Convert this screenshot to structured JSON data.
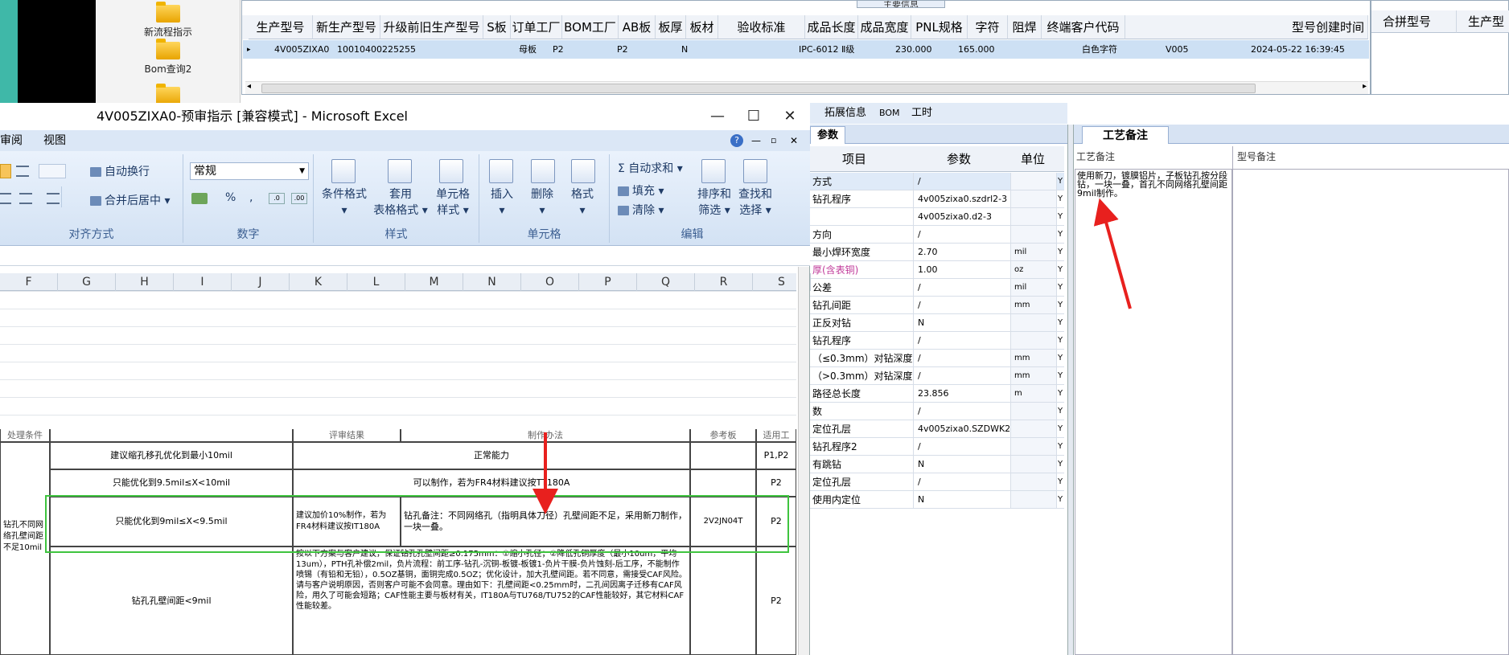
{
  "desktop": {
    "icons": [
      {
        "label": "新流程指示"
      },
      {
        "label": "Bom查询2"
      },
      {
        "label": ""
      }
    ]
  },
  "top_grid": {
    "tab_label": "主要信息",
    "columns": [
      "生产型号",
      "新生产型号",
      "升级前旧生产型号",
      "S板",
      "订单工厂",
      "BOM工厂",
      "AB板",
      "板厚",
      "板材",
      "验收标准",
      "成品长度",
      "成品宽度",
      "PNL规格",
      "字符",
      "阻焊",
      "终端客户代码",
      "型号创建时间"
    ],
    "row": {
      "marker": "▸",
      "production_model": "4V005ZIXA0",
      "new_model": "10010400225255",
      "old_model": "",
      "s_board": "母板",
      "order_factory": "P2",
      "bom_factory": "P2",
      "ab_board": "N",
      "thickness": "",
      "material": "",
      "standard": "IPC-6012 Ⅱ级",
      "length": "230.000",
      "width": "165.000",
      "pnl": "",
      "character": "白色字符",
      "solder_mask": "",
      "customer_code": "V005",
      "created_time": "2024-05-22 16:39:45"
    }
  },
  "merge_grid": {
    "columns": [
      "合拼型号",
      "生产型"
    ]
  },
  "excel": {
    "window_title": "4V005ZIXA0-预审指示  [兼容模式] - Microsoft Excel",
    "win_min": "—",
    "win_max": "☐",
    "win_close": "✕",
    "tabs": [
      "审阅",
      "视图"
    ],
    "help_icon": "?",
    "ribbon": {
      "alignment": {
        "wrap": "自动换行",
        "merge": "合并后居中 ▾",
        "label": "对齐方式"
      },
      "number": {
        "format": "常规",
        "label": "数字",
        "percent": "%",
        "comma": ","
      },
      "styles": {
        "cond": "条件格式",
        "cond2": "▾",
        "table": "套用",
        "table2": "表格格式 ▾",
        "cell": "单元格",
        "cell2": "样式 ▾",
        "label": "样式"
      },
      "cells": {
        "insert": "插入",
        "delete": "删除",
        "format": "格式",
        "label": "单元格"
      },
      "edit": {
        "autosum": "Σ 自动求和 ▾",
        "fill": "填充 ▾",
        "clear": "清除 ▾",
        "sort": "排序和",
        "sort2": "筛选 ▾",
        "find": "查找和",
        "find2": "选择 ▾",
        "label": "编辑"
      }
    },
    "columns": [
      "F",
      "G",
      "H",
      "I",
      "J",
      "K",
      "L",
      "M",
      "N",
      "O",
      "P",
      "Q",
      "R",
      "S"
    ],
    "table": {
      "headers": [
        "处理条件",
        "评审结果",
        "制作办法",
        "参考板",
        "适用工"
      ],
      "left_cell": "钻孔不同网络孔壁间距不足10mil",
      "rows": [
        {
          "cond": "建议缩孔移孔优化到最小10mil",
          "result": "正常能力",
          "ref": "",
          "apply": "P1,P2"
        },
        {
          "cond": "只能优化到9.5mil≤X<10mil",
          "result": "可以制作，若为FR4材料建议按TT180A",
          "ref": "",
          "apply": "P2"
        },
        {
          "cond": "只能优化到9mil≤X<9.5mil",
          "result": "建议加价10%制作，若为FR4材料建议按IT180A",
          "method": "钻孔备注：不同网络孔（指明具体刀径）孔壁间距不足，采用新刀制作，一块一叠。",
          "ref": "2V2JN04T",
          "apply": "P2"
        },
        {
          "cond": "钻孔孔壁间距<9mil",
          "result": "按以下方案与客户建议，保证钻孔孔壁间距≥0.175mm：①缩小孔径；②降低孔铜厚度（最小10um，平均13um），PTH孔补偿2mil，负片流程：前工序-钻孔-沉铜-板镀-板镀1-负片干膜-负片蚀刻-后工序，不能制作喷锡（有铅和无铅），0.5OZ基铜，面铜完成0.5OZ；优化设计，加大孔壁间距。若不同意，需接受CAF风险。请与客户说明原因，否则客户可能不会同意。理由如下：孔壁间距<0.25mm时，二孔间因离子迁移有CAF风险，用久了可能会短路；CAF性能主要与板材有关，IT180A与TU768/TU752的CAF性能较好，其它材料CAF性能较差。",
          "ref": "",
          "apply": "P2"
        }
      ]
    }
  },
  "mid_panel": {
    "tabs": [
      "拓展信息",
      "BOM",
      "工时"
    ],
    "param_tab": "参数",
    "headers": [
      "项目",
      "参数",
      "单位"
    ],
    "rows": [
      {
        "item": "方式",
        "value": "/",
        "unit": "",
        "flag": "Y"
      },
      {
        "item": "钻孔程序",
        "value": "4v005zixa0.szdrl2-3",
        "unit": "",
        "flag": "Y"
      },
      {
        "item": "",
        "value": "4v005zixa0.d2-3",
        "unit": "",
        "flag": "Y"
      },
      {
        "item": "方向",
        "value": "/",
        "unit": "",
        "flag": "Y"
      },
      {
        "item": "最小焊环宽度",
        "value": "2.70",
        "unit": "mil",
        "flag": "Y"
      },
      {
        "item": "厚(含表铜)",
        "value": "1.00",
        "unit": "oz",
        "flag": "Y"
      },
      {
        "item": "公差",
        "value": "/",
        "unit": "mil",
        "flag": "Y"
      },
      {
        "item": "钻孔间距",
        "value": "/",
        "unit": "mm",
        "flag": "Y"
      },
      {
        "item": "正反对钻",
        "value": "N",
        "unit": "",
        "flag": "Y"
      },
      {
        "item": "钻孔程序",
        "value": "/",
        "unit": "",
        "flag": "Y"
      },
      {
        "item": "（≤0.3mm）对钻深度",
        "value": "/",
        "unit": "mm",
        "flag": "Y"
      },
      {
        "item": "（>0.3mm）对钻深度",
        "value": "/",
        "unit": "mm",
        "flag": "Y"
      },
      {
        "item": "路径总长度",
        "value": "23.856",
        "unit": "m",
        "flag": "Y"
      },
      {
        "item": "数",
        "value": "/",
        "unit": "",
        "flag": "Y"
      },
      {
        "item": "定位孔层",
        "value": "4v005zixa0.SZDWK2-3",
        "unit": "",
        "flag": "Y"
      },
      {
        "item": "钻孔程序2",
        "value": "/",
        "unit": "",
        "flag": "Y"
      },
      {
        "item": "有跳钻",
        "value": "N",
        "unit": "",
        "flag": "Y"
      },
      {
        "item": "定位孔层",
        "value": "/",
        "unit": "",
        "flag": "Y"
      },
      {
        "item": "使用内定位",
        "value": "N",
        "unit": "",
        "flag": "Y"
      }
    ]
  },
  "notes_panel": {
    "tab": "工艺备注",
    "label_process": "工艺备注",
    "label_model": "型号备注",
    "process_note": "使用新刀，镀膜铝片，子板钻孔按分段钻，一块一叠，首孔不同网络孔壁间距9mil制作。",
    "model_note": ""
  },
  "colors": {
    "annotation_arrow": "#e8201e",
    "highlight_box": "#3fc43f",
    "selected_row": "#cde0f4",
    "ribbon_bg": "#dbe7f6"
  }
}
